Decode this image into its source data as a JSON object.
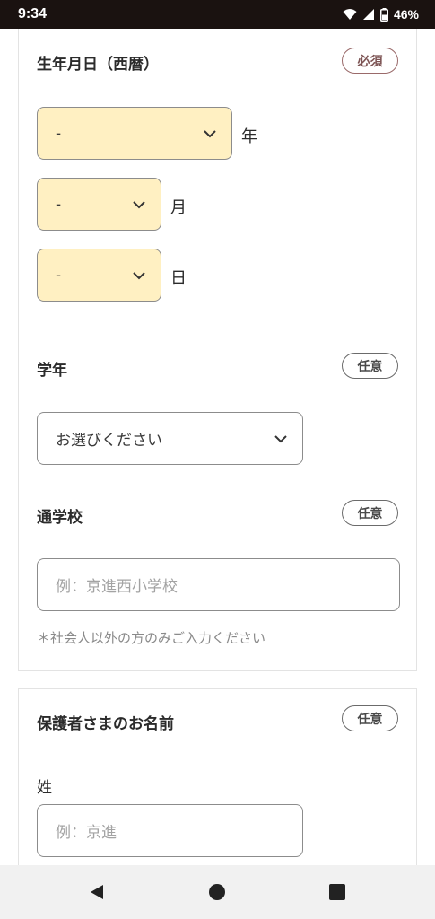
{
  "status": {
    "time": "9:34",
    "battery": "46%"
  },
  "birthdate": {
    "title": "生年月日（西暦）",
    "badge": "必須",
    "year_value": "-",
    "year_unit": "年",
    "month_value": "-",
    "month_unit": "月",
    "day_value": "-",
    "day_unit": "日"
  },
  "grade": {
    "title": "学年",
    "badge": "任意",
    "value": "お選びください"
  },
  "school": {
    "title": "通学校",
    "badge": "任意",
    "placeholder": "例：京進西小学校",
    "note": "＊社会人以外の方のみご入力ください"
  },
  "guardian": {
    "title": "保護者さまのお名前",
    "badge": "任意",
    "surname_label": "姓",
    "surname_placeholder": "例：京進"
  },
  "colors": {
    "highlight": "#fff0c2",
    "required_accent": "#7d5454",
    "status_bar": "#1a1210"
  }
}
